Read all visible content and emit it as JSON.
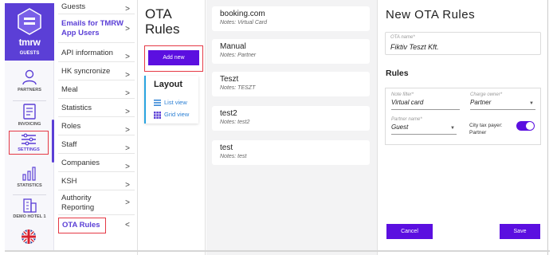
{
  "rail": {
    "brand": {
      "logo_text": "tmrw",
      "section": "GUESTS"
    },
    "items": [
      {
        "label": "PARTNERS",
        "icon": "partners-icon"
      },
      {
        "label": "INVOICING",
        "icon": "invoice-icon"
      },
      {
        "label": "SETTINGS",
        "icon": "settings-icon",
        "active": true
      },
      {
        "label": "STATISTICS",
        "icon": "statistics-icon"
      },
      {
        "label": "DEMO HOTEL 1",
        "icon": "hotel-icon"
      }
    ],
    "language_icon": "uk-flag-icon"
  },
  "menu": {
    "items": [
      {
        "label": "Guests"
      },
      {
        "label": "Emails for TMRW App Users",
        "highlight": true
      },
      {
        "label": "API information"
      },
      {
        "label": "HK syncronize"
      },
      {
        "label": "Meal"
      },
      {
        "label": "Statistics"
      },
      {
        "label": "Roles"
      },
      {
        "label": "Staff"
      },
      {
        "label": "Companies"
      },
      {
        "label": "KSH"
      },
      {
        "label": "Authority Reporting"
      },
      {
        "label": "OTA Rules",
        "current": true
      }
    ]
  },
  "ota": {
    "title": "OTA Rules",
    "add_button": "Add new",
    "layout": {
      "title": "Layout",
      "list_view": "List view",
      "grid_view": "Grid view"
    }
  },
  "rules": [
    {
      "name": "booking.com",
      "notes": "Notes: Virtual Card"
    },
    {
      "name": "Manual",
      "notes": "Notes: Partner"
    },
    {
      "name": "Teszt",
      "notes": "Notes: TESZT"
    },
    {
      "name": "test2",
      "notes": "Notes: test2"
    },
    {
      "name": "test",
      "notes": "Notes: test"
    }
  ],
  "editor": {
    "title": "New OTA Rules",
    "ota_name_label": "OTA name*",
    "ota_name_value": "Fiktiv Teszt Kft.",
    "rules_header": "Rules",
    "note_filter_label": "Note filter*",
    "note_filter_value": "Virtual card",
    "charge_owner_label": "Charge owner*",
    "charge_owner_value": "Partner",
    "partner_name_label": "Partner name*",
    "partner_name_value": "Guest",
    "city_tax_label": "City tax payer:",
    "city_tax_value": "Partner",
    "city_tax_on": true,
    "cancel_button": "Cancel",
    "save_button": "Save"
  },
  "colors": {
    "brand": "#5b3fd6",
    "button": "#5b0fe0",
    "highlight_border": "#e53945"
  }
}
